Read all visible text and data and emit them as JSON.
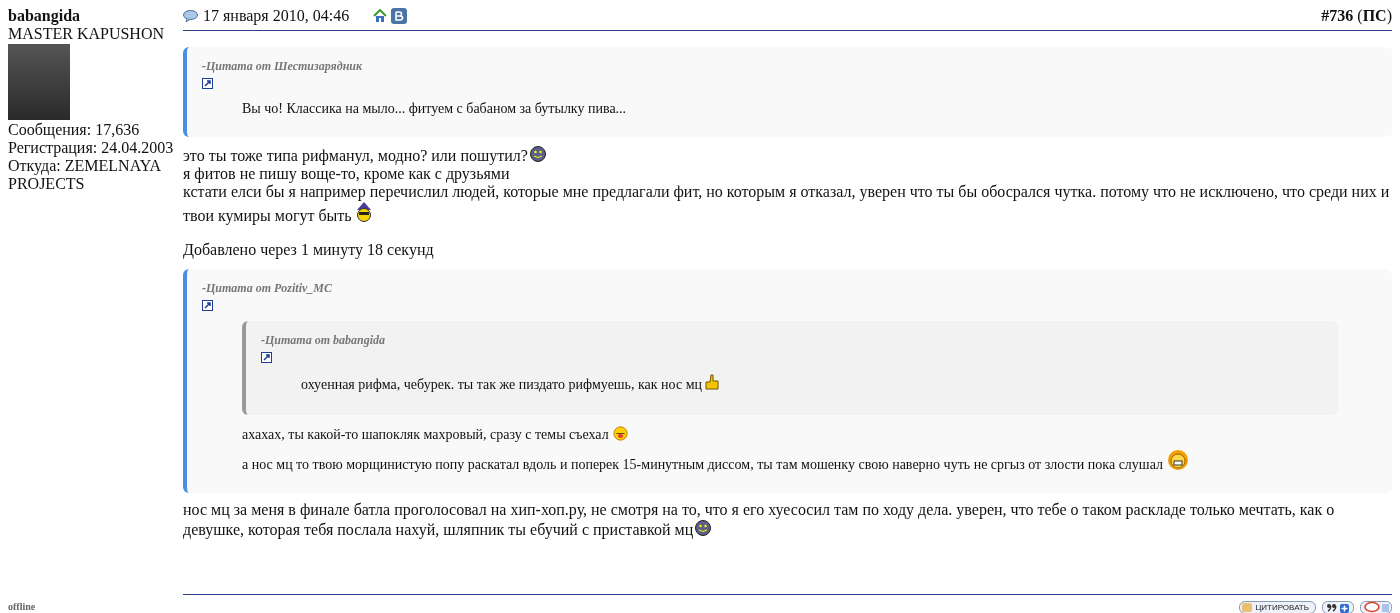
{
  "user": {
    "name": "babangida",
    "title": "MASTER KAPUSHON",
    "stats": [
      "Сообщения: 17,636",
      "Регистрация: 24.04.2003",
      "Откуда: ZEMELNAYA PROJECTS"
    ],
    "status": "offline"
  },
  "post": {
    "date": "17 января 2010, 04:46",
    "number": "**#736** (**ПС**)",
    "body": [
      {
        "kind": "quote",
        "author": "-Цитата от Шестизарядник",
        "body": [
          {
            "kind": "text",
            "text": "Вы чо! Классика на мыло... фитуем с бабаном за бутылку пива..."
          }
        ]
      },
      {
        "kind": "text",
        "text": "это ты тоже типа рифманул, модно? или пошутил?",
        "smiley": {
          "kind": "grin"
        }
      },
      {
        "kind": "text",
        "text": "я фитов не пишу воще-то, кроме как с друзьями"
      },
      {
        "kind": "text",
        "text": "кстати елси бы я например перечислил людей, которые мне предлагали фит, но которым я отказал, уверен что ты бы обосрался чутка. потому что не исключено, что среди них и твои кумиры могут быть",
        "smiley": {
          "kind": "wizard"
        }
      },
      {
        "kind": "note",
        "text": "Добавлено через 1 минуту 18 секунд"
      },
      {
        "kind": "quote",
        "author": "-Цитата от Pozitiv_MC",
        "body": [
          {
            "kind": "quote",
            "author": "-Цитата от babangida",
            "body": [
              {
                "kind": "text",
                "text": "охуенная рифма, чебурек. ты так же пиздато рифмуешь, как нос мц",
                "smiley": {
                  "kind": "thumbs"
                }
              }
            ]
          },
          {
            "kind": "text",
            "text": "ахахах, ты какой-то шапокляк махровый, сразу с темы съехал ",
            "smiley": {
              "kind": "tongue"
            }
          },
          {
            "kind": "text",
            "text": "а нос мц то твою морщинистую попу раскатал вдоль и поперек 15-минутным диссом, ты там мошенку свою наверно чуть не сргыз от злости пока слушал ",
            "smiley": {
              "kind": "laugh"
            }
          }
        ]
      },
      {
        "kind": "text",
        "text": "нос мц за меня в финале батла проголосовал на хип-хоп.ру, не смотря на то, что я его хуесосил там по ходу дела. уверен, что тебе о таком раскладе только мечтать, как о девушке, которая тебя послала нахуй, шляпник ты ебучий с приставкой мц",
        "smiley": {
          "kind": "grin"
        }
      }
    ],
    "buttons": [
      {
        "kind": "quote",
        "label": "ЦИТИРОВАТЬ"
      },
      {
        "kind": "multiquote"
      },
      {
        "kind": "reply"
      }
    ]
  }
}
